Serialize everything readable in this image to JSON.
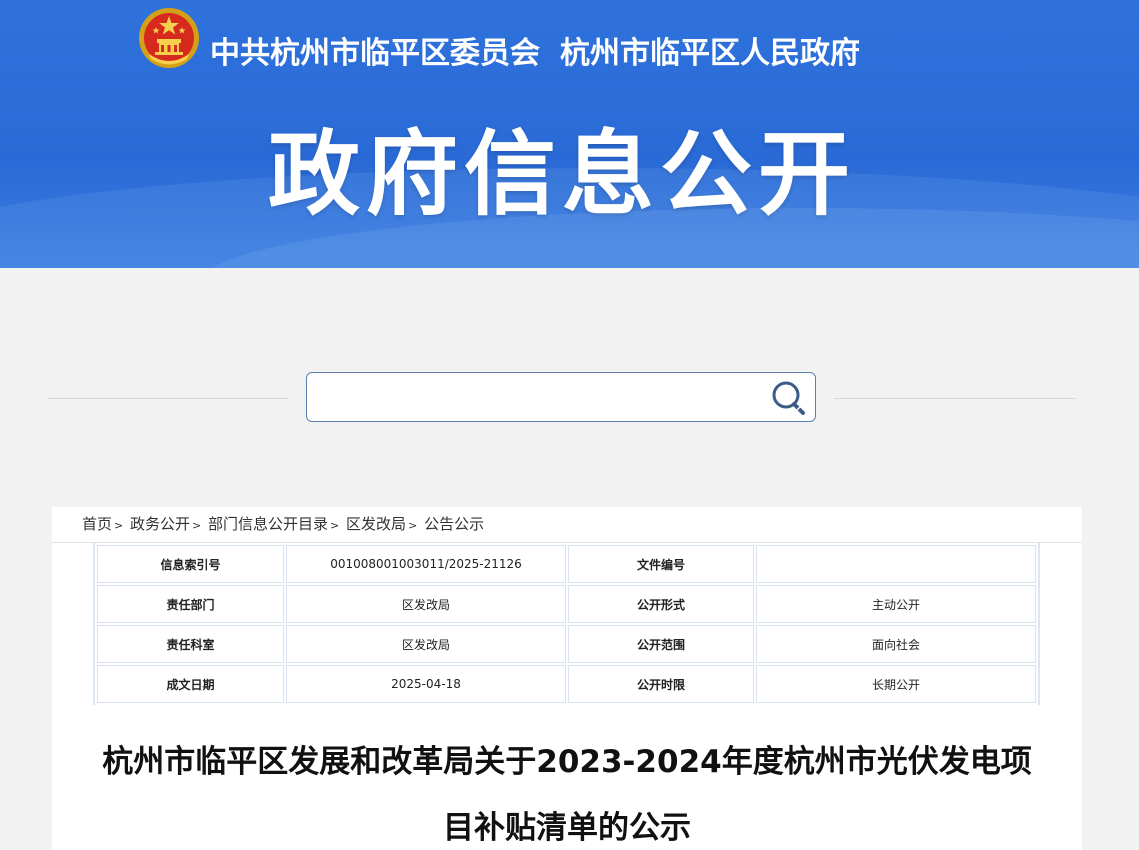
{
  "header": {
    "org_party": "中共杭州市临平区委员会",
    "org_gov": "杭州市临平区人民政府",
    "banner_title": "政府信息公开",
    "emblem_icon": "national-emblem-icon",
    "brand_color": "#2f72dc"
  },
  "search": {
    "placeholder": "",
    "value": "",
    "icon": "search-icon"
  },
  "breadcrumb": {
    "items": [
      "首页",
      "政务公开",
      "部门信息公开目录",
      "区发改局",
      "公告公示"
    ],
    "separator": ">"
  },
  "meta_table": {
    "rows": [
      {
        "k1": "信息索引号",
        "v1": "001008001003011/2025-21126",
        "k2": "文件编号",
        "v2": ""
      },
      {
        "k1": "责任部门",
        "v1": "区发改局",
        "k2": "公开形式",
        "v2": "主动公开"
      },
      {
        "k1": "责任科室",
        "v1": "区发改局",
        "k2": "公开范围",
        "v2": "面向社会"
      },
      {
        "k1": "成文日期",
        "v1": "2025-04-18",
        "k2": "公开时限",
        "v2": "长期公开"
      }
    ]
  },
  "document": {
    "title_line1": "杭州市临平区发展和改革局关于2023-2024年度杭州市光伏发电项",
    "title_line2": "目补贴清单的公示"
  }
}
